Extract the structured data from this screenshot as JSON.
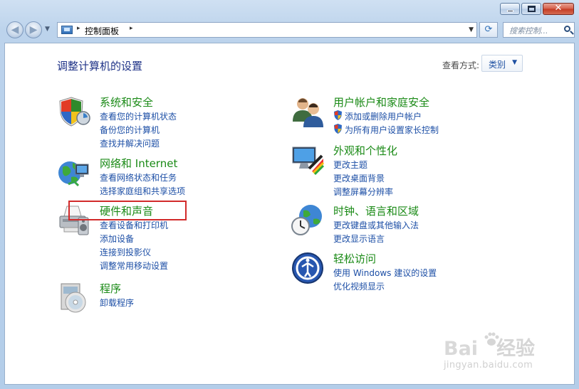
{
  "window": {
    "caption_buttons": {
      "minimize": "minimize",
      "maximize": "maximize",
      "close": "✕"
    }
  },
  "nav": {
    "back_arrow": "◀",
    "forward_arrow": "▶",
    "recent_arrow": "▼",
    "address_separator": "▸",
    "address": "控制面板",
    "address_dropdown": "▼",
    "refresh": "⟳",
    "search_placeholder": "搜索控制..."
  },
  "main": {
    "title": "调整计算机的设置",
    "view_by_label": "查看方式:",
    "view_by_value": "类别",
    "view_by_arrow": "▼"
  },
  "categories": [
    {
      "title": "系统和安全",
      "icon": "system-security-shield-icon",
      "links": [
        "查看您的计算机状态",
        "备份您的计算机",
        "查找并解决问题"
      ]
    },
    {
      "title": "网络和 Internet",
      "icon": "network-globe-icon",
      "links": [
        "查看网络状态和任务",
        "选择家庭组和共享选项"
      ]
    },
    {
      "title": "硬件和声音",
      "icon": "printer-hardware-icon",
      "links": [
        "查看设备和打印机",
        "添加设备",
        "连接到投影仪",
        "调整常用移动设置"
      ]
    },
    {
      "title": "程序",
      "icon": "programs-disc-icon",
      "links": [
        "卸载程序"
      ]
    },
    {
      "title": "用户帐户和家庭安全",
      "icon": "user-accounts-icon",
      "links": [
        "添加或删除用户帐户",
        "为所有用户设置家长控制"
      ]
    },
    {
      "title": "外观和个性化",
      "icon": "appearance-monitor-icon",
      "links": [
        "更改主题",
        "更改桌面背景",
        "调整屏幕分辨率"
      ]
    },
    {
      "title": "时钟、语言和区域",
      "icon": "clock-globe-icon",
      "links": [
        "更改键盘或其他输入法",
        "更改显示语言"
      ]
    },
    {
      "title": "轻松访问",
      "icon": "ease-of-access-icon",
      "links": [
        "使用 Windows 建议的设置",
        "优化视频显示"
      ]
    }
  ],
  "watermark": {
    "logo_left": "Bai",
    "logo_right": "经验",
    "url": "jingyan.baidu.com"
  },
  "colors": {
    "category_title": "#1a8a16",
    "link": "#1d4fa6",
    "page_title": "#1e3287",
    "highlight_box": "#d22a2a"
  }
}
